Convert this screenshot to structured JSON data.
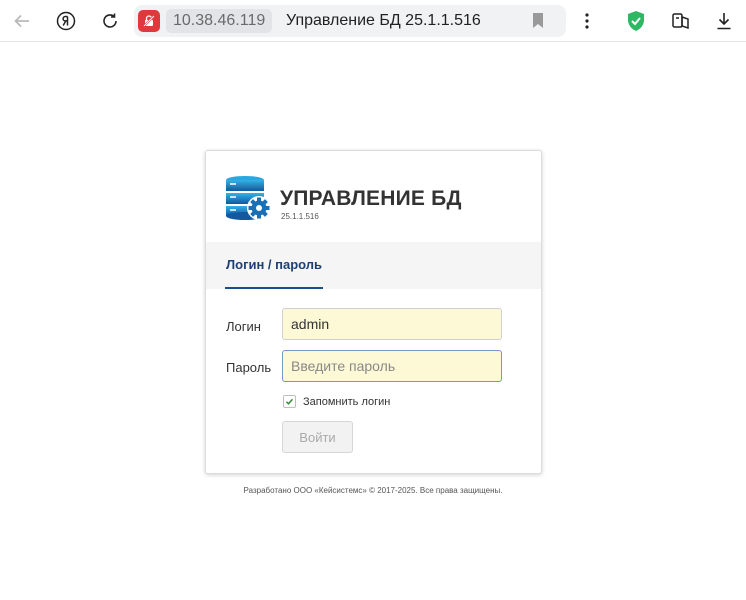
{
  "browser": {
    "address": "10.38.46.119",
    "tab_title": "Управление БД 25.1.1.516"
  },
  "app": {
    "title": "УПРАВЛЕНИЕ БД",
    "version": "25.1.1.516"
  },
  "tabs": [
    {
      "label": "Логин / пароль",
      "active": true
    }
  ],
  "form": {
    "login_label": "Логин",
    "login_value": "admin",
    "password_label": "Пароль",
    "password_placeholder": "Введите пароль",
    "remember_label": "Запомнить логин",
    "remember_checked": true,
    "submit_label": "Войти"
  },
  "footer": "Разработано ООО «Кейсистемс» © 2017-2025. Все права защищены.",
  "colors": {
    "accent": "#1e4b8a",
    "field_bg": "#fdf9d6",
    "lock_red": "#e0383b",
    "shield_green": "#2fb864",
    "logo_blue": "#1a84c9"
  }
}
